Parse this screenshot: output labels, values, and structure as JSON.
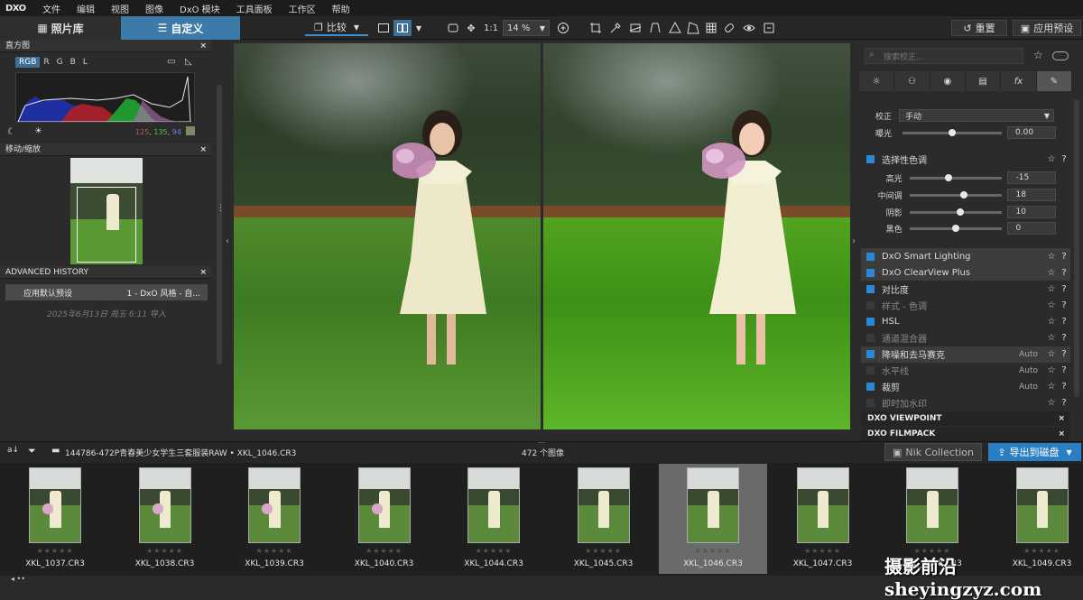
{
  "app": {
    "logo": "DXO"
  },
  "menu": [
    "文件",
    "编辑",
    "视图",
    "图像",
    "DxO 模块",
    "工具面板",
    "工作区",
    "帮助"
  ],
  "toolbar": {
    "tab_photolib": "照片库",
    "tab_custom": "自定义",
    "compare": "比较",
    "ratio": "1:1",
    "zoom": "14 %",
    "reset": "重置",
    "apply_preset": "应用预设"
  },
  "left": {
    "histogram_title": "直方图",
    "histogram_tabs": [
      "RGB",
      "R",
      "G",
      "B",
      "L"
    ],
    "histogram_values": {
      "r": "125",
      "g": "135",
      "b": "94"
    },
    "move_zoom_title": "移动/缩放",
    "history_title": "ADVANCED HISTORY",
    "history_item": {
      "name": "应用默认预设",
      "value": "1 - DxO 风格 - 自..."
    },
    "history_date": "2025年6月13日 周五 6:11 导入"
  },
  "right": {
    "search_placeholder": "搜索校正...",
    "correction_label": "校正",
    "correction_value": "手动",
    "exposure_label": "曝光",
    "exposure_value": "0.00",
    "selective_tone": "选择性色调",
    "tones": [
      {
        "label": "高光",
        "value": "-15",
        "level": 0.42
      },
      {
        "label": "中间调",
        "value": "18",
        "level": 0.59
      },
      {
        "label": "阴影",
        "value": "10",
        "level": 0.55
      },
      {
        "label": "黑色",
        "value": "0",
        "level": 0.5
      }
    ],
    "exposure_level": 0.5,
    "modules": [
      {
        "label": "DxO Smart Lighting",
        "on": true,
        "dim": false,
        "sel": true,
        "auto": ""
      },
      {
        "label": "DxO ClearView Plus",
        "on": true,
        "dim": false,
        "sel": true,
        "auto": ""
      },
      {
        "label": "对比度",
        "on": true,
        "dim": false,
        "sel": false,
        "auto": ""
      },
      {
        "label": "样式 - 色调",
        "on": false,
        "dim": true,
        "sel": false,
        "auto": ""
      },
      {
        "label": "HSL",
        "on": true,
        "dim": false,
        "sel": false,
        "auto": ""
      },
      {
        "label": "通道混合器",
        "on": false,
        "dim": true,
        "sel": false,
        "auto": ""
      },
      {
        "label": "降噪和去马赛克",
        "on": true,
        "dim": false,
        "sel": true,
        "auto": "Auto"
      },
      {
        "label": "水平线",
        "on": false,
        "dim": true,
        "sel": false,
        "auto": "Auto"
      },
      {
        "label": "裁剪",
        "on": true,
        "dim": false,
        "sel": false,
        "auto": "Auto"
      },
      {
        "label": "即时加水印",
        "on": false,
        "dim": true,
        "sel": false,
        "auto": ""
      }
    ],
    "section_viewpoint": "DXO VIEWPOINT",
    "section_filmpack": "DXO FILMPACK"
  },
  "filmbar": {
    "path": "144786-472P青春美少女学生三套服装RAW",
    "file": "XKL_1046.CR3",
    "count": "472 个图像",
    "nik": "Nik Collection",
    "export": "导出到磁盘"
  },
  "filmstrip": [
    {
      "name": "XKL_1037.CR3",
      "sel": false
    },
    {
      "name": "XKL_1038.CR3",
      "sel": false
    },
    {
      "name": "XKL_1039.CR3",
      "sel": false
    },
    {
      "name": "XKL_1040.CR3",
      "sel": false
    },
    {
      "name": "XKL_1044.CR3",
      "sel": false
    },
    {
      "name": "XKL_1045.CR3",
      "sel": false
    },
    {
      "name": "XKL_1046.CR3",
      "sel": true
    },
    {
      "name": "XKL_1047.CR3",
      "sel": false
    },
    {
      "name": "XKL_1048.CR3",
      "sel": false
    },
    {
      "name": "XKL_1049.CR3",
      "sel": false
    }
  ],
  "watermark": "摄影前沿 sheyingzyz.com",
  "colors": {
    "accent": "#3d7aa8",
    "export": "#2a7ec4",
    "checkbox": "#2a88d8"
  }
}
